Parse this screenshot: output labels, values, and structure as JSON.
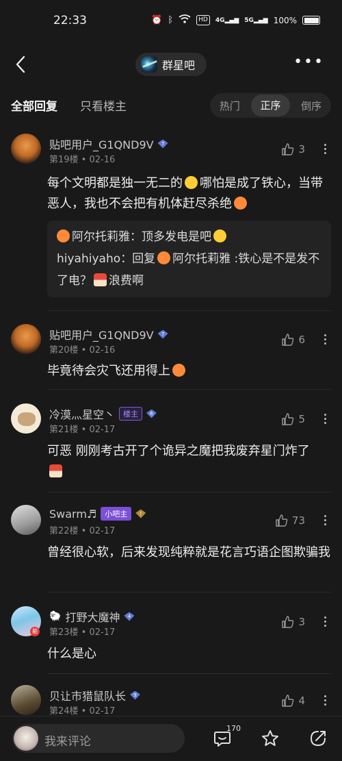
{
  "status_bar": {
    "time": "22:33",
    "battery": "100%",
    "hd": "HD",
    "net1": "4G",
    "net2": "5G"
  },
  "header": {
    "forum_name": "群星吧"
  },
  "tabs": {
    "all": "全部回复",
    "op_only": "只看楼主",
    "sort": [
      "热门",
      "正序",
      "倒序"
    ],
    "sort_active": 1
  },
  "posts": [
    {
      "username": "贴吧用户_G1QND9V",
      "level": "7",
      "floor": "第19楼",
      "date": "02-16",
      "likes": "3",
      "content_a": "每个文明都是独一无二的",
      "content_b": "哪怕是成了铁心，当带恶人，我也不会把有机体赶尽杀绝",
      "quote": {
        "name1": "阿尔托莉雅",
        "text1": "：顶多发电是吧",
        "name2": "hiyahiyaho",
        "text2": "：回复",
        "reply_to": "阿尔托莉雅",
        "text3": " :铁心是不是发不了电？",
        "text4": "浪费啊"
      }
    },
    {
      "username": "贴吧用户_G1QND9V",
      "level": "7",
      "floor": "第20楼",
      "date": "02-16",
      "likes": "6",
      "content": "毕竟待会灾飞还用得上"
    },
    {
      "username": "冷漠灬星空丶",
      "tag": "楼主",
      "level": "6",
      "floor": "第21楼",
      "date": "02-17",
      "likes": "5",
      "content": "可恶 刚刚考古开了个诡异之魔把我废弃星门炸了"
    },
    {
      "username": "Swarm♬",
      "tag": "小吧主",
      "level": "!",
      "floor": "第22楼",
      "date": "02-17",
      "likes": "73",
      "content": "曾经很心软，后来发现纯粹就是花言巧语企图欺骗我"
    },
    {
      "username": "打野大魔神",
      "level": "4",
      "floor": "第23楼",
      "date": "02-17",
      "likes": "3",
      "content": "什么是心",
      "avatar_badge": "舶"
    },
    {
      "username": "贝让市猎鼠队长",
      "level": "9",
      "floor": "第24楼",
      "date": "02-17",
      "likes": "4"
    }
  ],
  "bottom_bar": {
    "placeholder": "我来评论",
    "comment_count": "170"
  },
  "colors": {
    "background": "#191919",
    "accent": "#7b4fd6",
    "level_badge": "#5e7bd6"
  }
}
